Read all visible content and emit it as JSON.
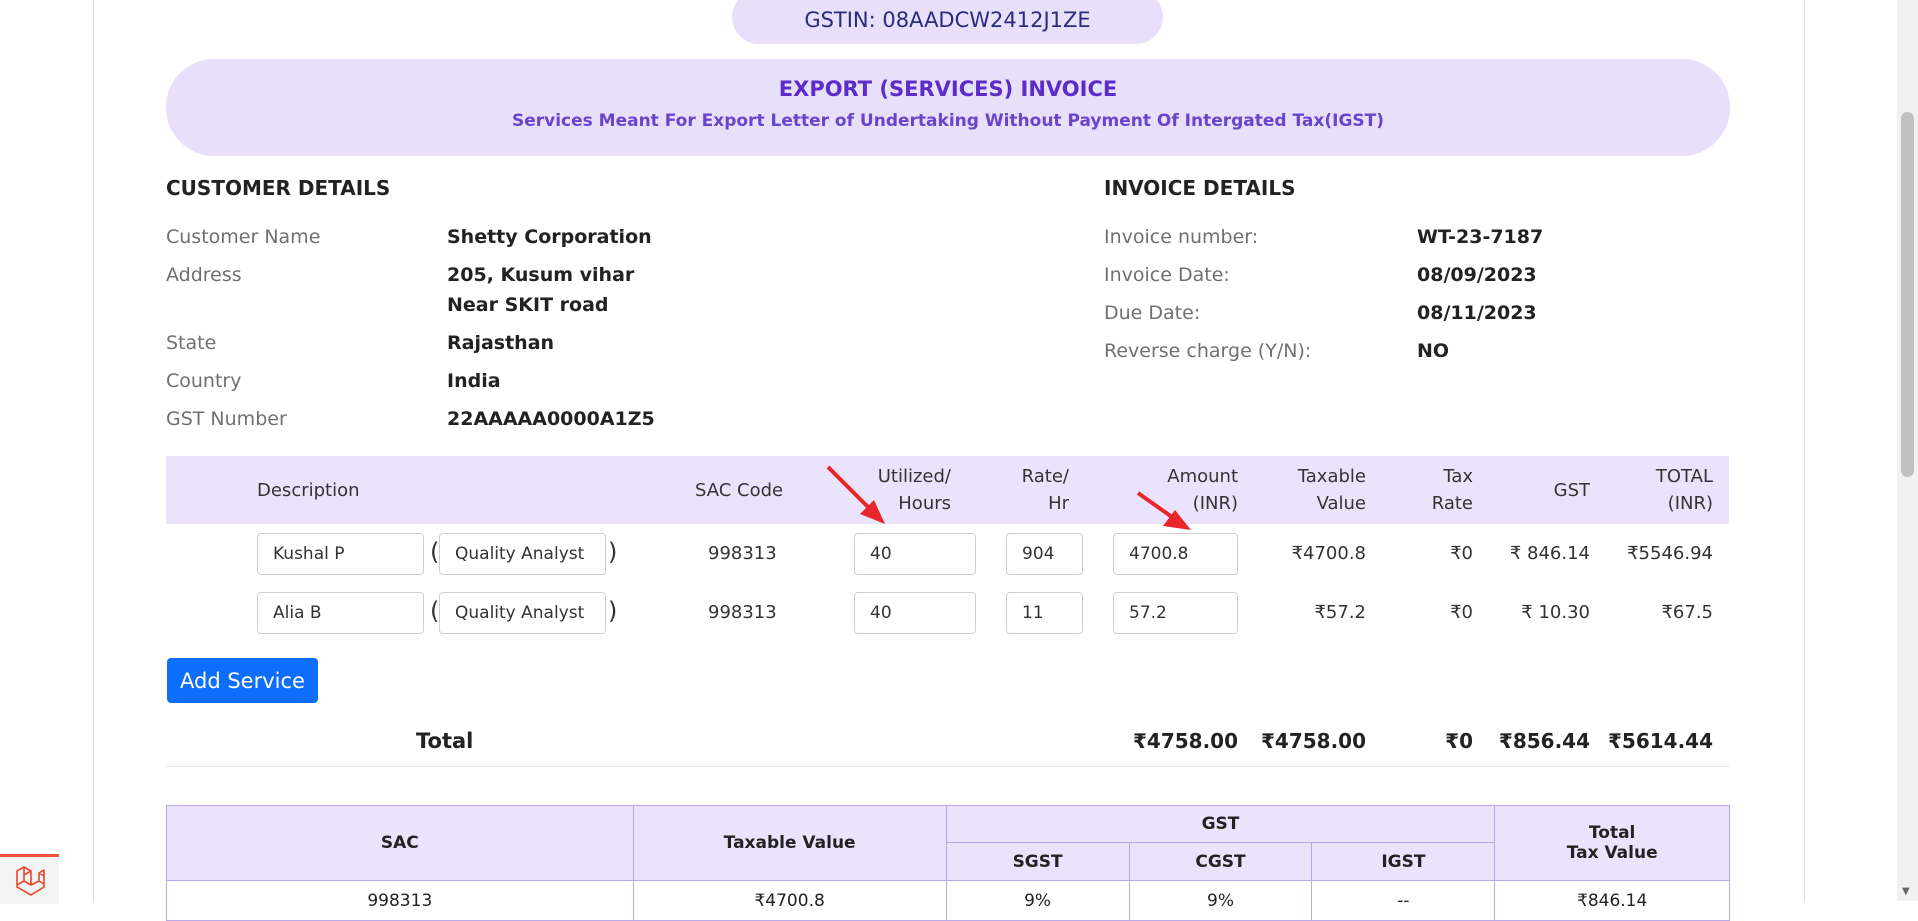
{
  "header": {
    "gstin": "GSTIN: 08AADCW2412J1ZE",
    "title": "EXPORT (SERVICES) INVOICE",
    "subtitle": "Services Meant For Export Letter of Undertaking Without Payment Of Intergated Tax(IGST)"
  },
  "customer": {
    "heading": "CUSTOMER DETAILS",
    "name_label": "Customer Name",
    "name": "Shetty Corporation",
    "address_label": "Address",
    "address_line1": "205, Kusum vihar",
    "address_line2": "Near SKIT road",
    "state_label": "State",
    "state": "Rajasthan",
    "country_label": "Country",
    "country": "India",
    "gst_label": "GST Number",
    "gst": "22AAAAA0000A1Z5"
  },
  "invoice": {
    "heading": "INVOICE DETAILS",
    "number_label": "Invoice number:",
    "number": "WT-23-7187",
    "date_label": "Invoice Date:",
    "date": "08/09/2023",
    "due_label": "Due Date:",
    "due": "08/11/2023",
    "reverse_label": "Reverse charge (Y/N):",
    "reverse": "NO"
  },
  "services_table": {
    "headers": {
      "description": "Description",
      "sac": "SAC Code",
      "hours_1": "Utilized/",
      "hours_2": "Hours",
      "rate_1": "Rate/",
      "rate_2": "Hr",
      "amount_1": "Amount",
      "amount_2": "(INR)",
      "taxable_1": "Taxable",
      "taxable_2": "Value",
      "taxrate_1": "Tax",
      "taxrate_2": "Rate",
      "gst": "GST",
      "total_1": "TOTAL",
      "total_2": "(INR)"
    },
    "rows": [
      {
        "name": "Kushal P",
        "role": "Quality Analyst",
        "sac": "998313",
        "hours": "40",
        "rate": "904",
        "amount": "4700.8",
        "taxable": "₹4700.8",
        "tax_rate": "₹0",
        "gst": "₹ 846.14",
        "total": "₹5546.94"
      },
      {
        "name": "Alia B",
        "role": "Quality Analyst",
        "sac": "998313",
        "hours": "40",
        "rate": "11",
        "amount": "57.2",
        "taxable": "₹57.2",
        "tax_rate": "₹0",
        "gst": "₹ 10.30",
        "total": "₹67.5"
      }
    ],
    "add_button": "Add Service"
  },
  "totals": {
    "label": "Total",
    "amount": "₹4758.00",
    "taxable": "₹4758.00",
    "tax_rate": "₹0",
    "gst": "₹856.44",
    "total": "₹5614.44"
  },
  "summary_table": {
    "sac": "SAC",
    "taxable": "Taxable Value",
    "gst": "GST",
    "sgst": "SGST",
    "cgst": "CGST",
    "igst": "IGST",
    "total_1": "Total",
    "total_2": "Tax Value",
    "row": {
      "sac": "998313",
      "taxable": "₹4700.8",
      "sgst": "9%",
      "cgst": "9%",
      "igst": "--",
      "total": "₹846.14"
    }
  },
  "colors": {
    "accent": "#5b2cc8",
    "header_bg": "#e8dffb",
    "button": "#0d6efd",
    "annotation_arrow": "#e8262c"
  }
}
